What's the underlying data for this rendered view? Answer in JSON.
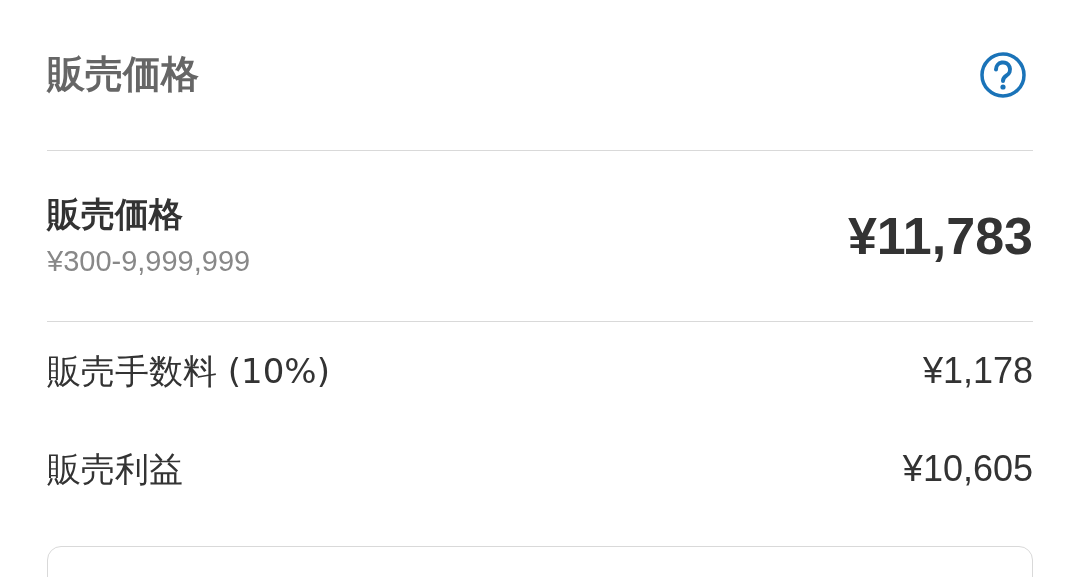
{
  "header": {
    "title": "販売価格"
  },
  "price": {
    "label": "販売価格",
    "range": "¥300-9,999,999",
    "value": "¥11,783"
  },
  "breakdown": [
    {
      "label": "販売手数料 (10%)",
      "value": "¥1,178"
    },
    {
      "label": "販売利益",
      "value": "¥10,605"
    }
  ]
}
